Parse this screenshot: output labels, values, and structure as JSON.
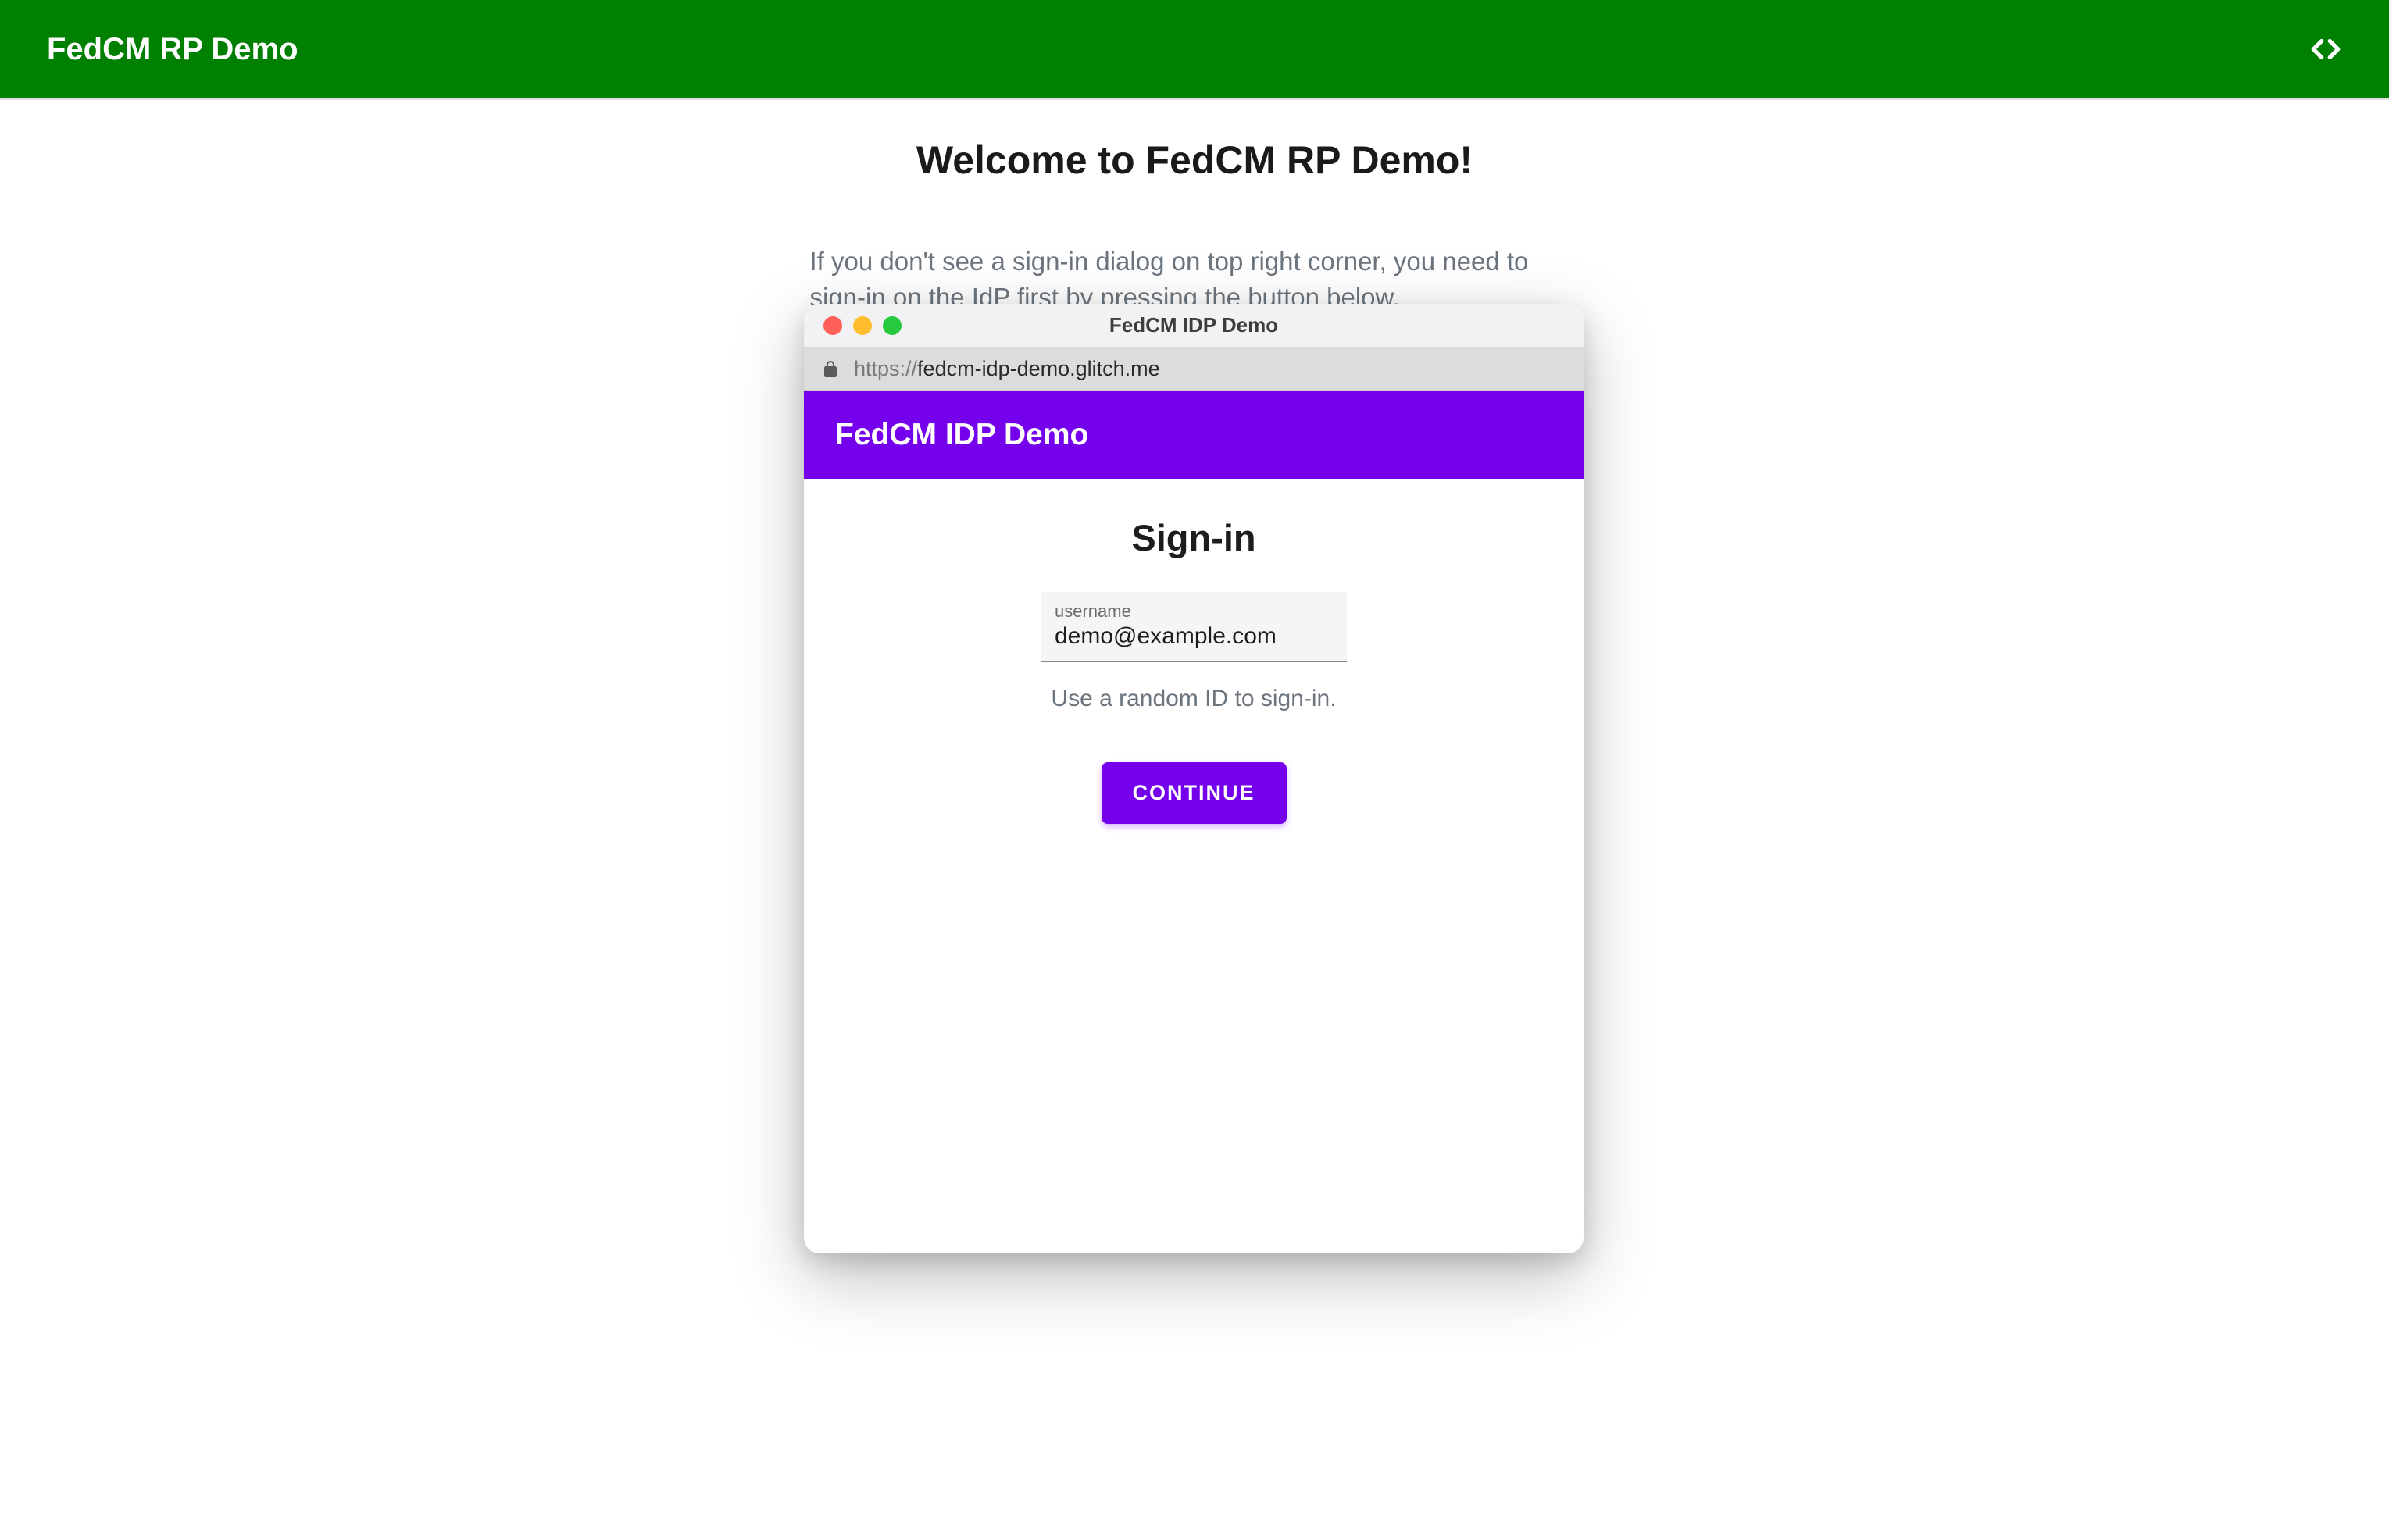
{
  "outer_header": {
    "title": "FedCM RP Demo"
  },
  "main": {
    "welcome_title": "Welcome to FedCM RP Demo!",
    "instruction": "If you don't see a sign-in dialog on top right corner, you need to sign-in on the IdP first by pressing the button below."
  },
  "popup": {
    "window_title": "FedCM IDP Demo",
    "url_protocol": "https://",
    "url_host": "fedcm-idp-demo.glitch.me",
    "idp_header_title": "FedCM IDP Demo",
    "signin_title": "Sign-in",
    "username_label": "username",
    "username_value": "demo@example.com",
    "helper_text": "Use a random ID to sign-in.",
    "continue_label": "CONTINUE"
  },
  "colors": {
    "outer_header_bg": "#008000",
    "idp_accent": "#7500eb"
  }
}
